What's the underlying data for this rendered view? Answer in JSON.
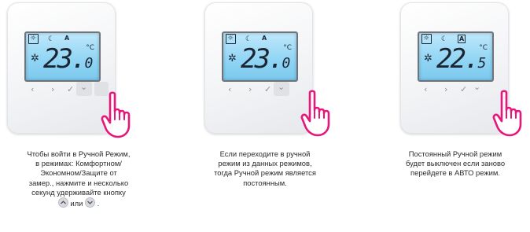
{
  "steps": [
    {
      "display": {
        "integer": "23",
        "decimal": "0",
        "unit": "°C",
        "a_boxed": false
      },
      "caption_lines": [
        "Чтобы войти в Ручной Режим,",
        "в режимах: Комфортном/",
        "Экономном/Защите от",
        "замер., нажмите и несколько",
        "секунд удерживайте кнопку"
      ],
      "caption_tail": {
        "or": "или",
        "end": "."
      }
    },
    {
      "display": {
        "integer": "23",
        "decimal": "0",
        "unit": "°C",
        "a_boxed": false
      },
      "caption_lines": [
        "Если переходите в ручной",
        "режим из данных режимов,",
        "тогда Ручной режим является",
        "постоянным."
      ]
    },
    {
      "display": {
        "integer": "22",
        "decimal": "5",
        "unit": "°C",
        "a_boxed": true
      },
      "caption_lines": [
        "Постоянный Ручной режим",
        "будет выключен если заново",
        "перейдете в АВТО режим."
      ]
    }
  ],
  "lcd_icons": {
    "sun": "☼",
    "moon": "☾",
    "mode": "A",
    "gear": "✲"
  },
  "buttons": {
    "left": "‹",
    "right": "›",
    "check": "✓",
    "down": "⌄"
  },
  "colors": {
    "hand": "#e8157a",
    "lcd": "#9bd8f5",
    "accent": "#e8157a"
  }
}
